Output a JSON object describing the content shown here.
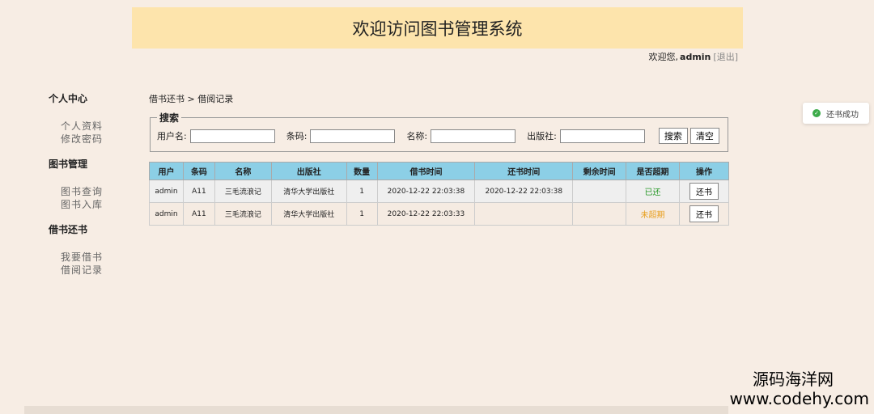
{
  "header": {
    "title": "欢迎访问图书管理系统"
  },
  "user_bar": {
    "greeting": "欢迎您,",
    "username": "admin",
    "logout": "[退出]"
  },
  "sidebar": {
    "groups": [
      {
        "title": "个人中心",
        "items": [
          "个人资料",
          "修改密码"
        ]
      },
      {
        "title": "图书管理",
        "items": [
          "图书查询",
          "图书入库"
        ]
      },
      {
        "title": "借书还书",
        "items": [
          "我要借书",
          "借阅记录"
        ]
      }
    ]
  },
  "breadcrumb": "借书还书 > 借阅记录",
  "search": {
    "legend": "搜索",
    "fields": [
      {
        "label": "用户名:",
        "value": ""
      },
      {
        "label": "条码:",
        "value": ""
      },
      {
        "label": "名称:",
        "value": ""
      },
      {
        "label": "出版社:",
        "value": ""
      }
    ],
    "search_button": "搜索",
    "clear_button": "清空"
  },
  "table": {
    "headers": [
      "用户",
      "条码",
      "名称",
      "出版社",
      "数量",
      "借书时间",
      "还书时间",
      "剩余时间",
      "是否超期",
      "操作"
    ],
    "rows": [
      {
        "user": "admin",
        "barcode": "A11",
        "name": "三毛流浪记",
        "publisher": "清华大学出版社",
        "qty": "1",
        "borrow_time": "2020-12-22 22:03:38",
        "return_time": "2020-12-22 22:03:38",
        "remaining": "",
        "status": "已还",
        "action": "还书"
      },
      {
        "user": "admin",
        "barcode": "A11",
        "name": "三毛流浪记",
        "publisher": "清华大学出版社",
        "qty": "1",
        "borrow_time": "2020-12-22 22:03:33",
        "return_time": "",
        "remaining": "",
        "status": "未超期",
        "action": "还书"
      }
    ]
  },
  "toast": {
    "message": "还书成功",
    "icon": "check-circle-icon"
  },
  "watermark": {
    "line1": "源码海洋网",
    "line2": "www.codehy.com"
  },
  "colors": {
    "header_bg": "#fde4ac",
    "table_header_bg": "#8ccfe6",
    "returned": "#2b9a2b",
    "not_overdue": "#e8a020",
    "success": "#3cab4a"
  }
}
